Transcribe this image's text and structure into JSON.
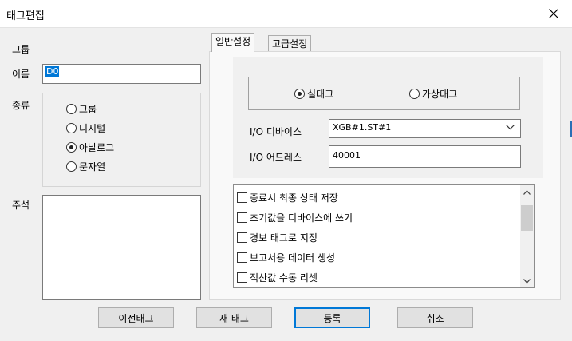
{
  "window": {
    "title": "태그편집",
    "close_icon": "close-icon"
  },
  "left": {
    "group_label": "그룹",
    "name_label": "이름",
    "name_value": "D0",
    "type_label": "종류",
    "type_options": [
      {
        "label": "그룹",
        "checked": false
      },
      {
        "label": "디지털",
        "checked": false
      },
      {
        "label": "아날로그",
        "checked": true
      },
      {
        "label": "문자열",
        "checked": false
      }
    ],
    "comment_label": "주석",
    "comment_value": ""
  },
  "tabs": [
    {
      "label": "일반설정",
      "active": true
    },
    {
      "label": "고급설정",
      "active": false
    }
  ],
  "general": {
    "tag_kind": [
      {
        "label": "실태그",
        "checked": true
      },
      {
        "label": "가상태그",
        "checked": false
      }
    ],
    "io_device_label": "I/O 디바이스",
    "io_device_value": "XGB#1.ST#1",
    "io_address_label": "I/O 어드레스",
    "io_address_value": "40001",
    "options": [
      {
        "label": "종료시 최종 상태 저장",
        "checked": false
      },
      {
        "label": "초기값을 디바이스에 쓰기",
        "checked": false
      },
      {
        "label": "경보 태그로 지정",
        "checked": false
      },
      {
        "label": "보고서용 데이터 생성",
        "checked": false
      },
      {
        "label": "적산값 수동 리셋",
        "checked": false
      }
    ]
  },
  "buttons": {
    "prev_tag": "이전태그",
    "new_tag": "새 태그",
    "register": "등록",
    "cancel": "취소"
  },
  "colors": {
    "selection": "#0078d7",
    "default_button_border": "#0078d7",
    "background": "#f0f0f0"
  }
}
